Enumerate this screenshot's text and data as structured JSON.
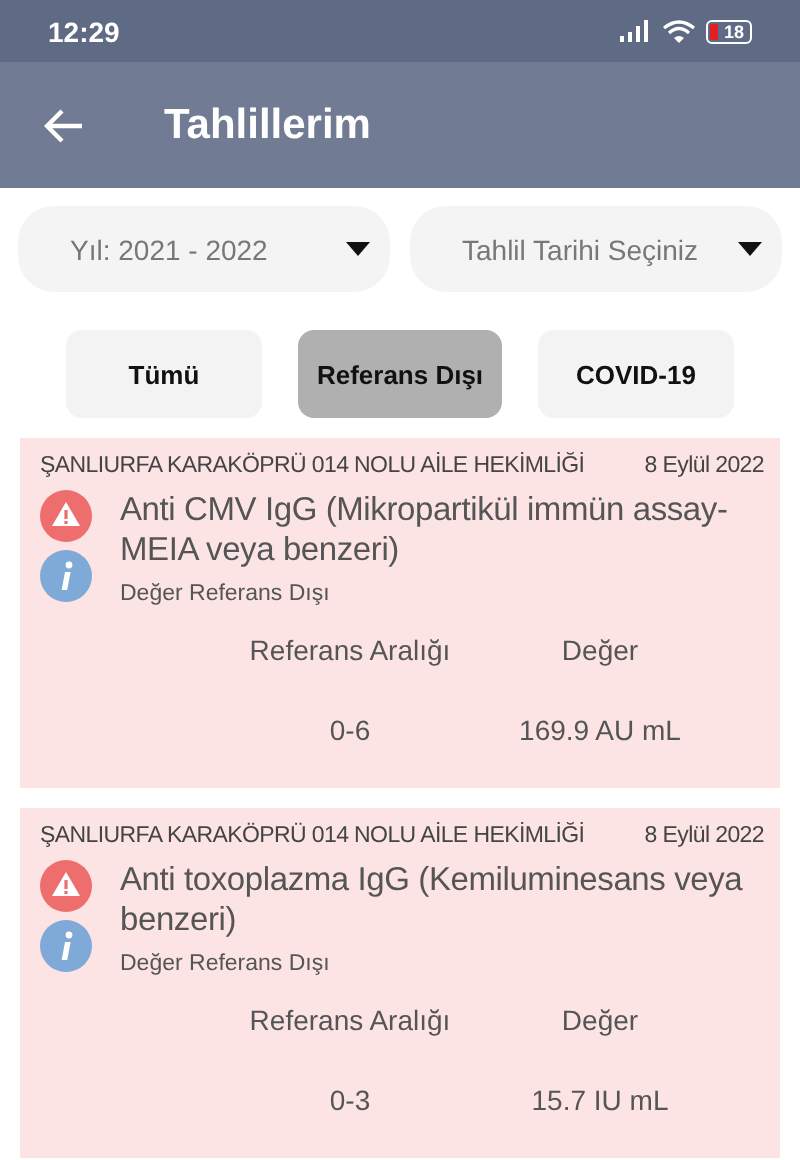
{
  "status_bar": {
    "time": "12:29",
    "battery": "18"
  },
  "app_bar": {
    "title": "Tahlillerim"
  },
  "dropdowns": [
    {
      "value": "Yıl: 2021 - 2022"
    },
    {
      "value": "Tahlil Tarihi Seçiniz"
    }
  ],
  "filters": [
    {
      "label": "Tümü",
      "selected": false
    },
    {
      "label": "Referans Dışı",
      "selected": true
    },
    {
      "label": "COVID-19",
      "selected": false
    }
  ],
  "results": [
    {
      "facility": "ŞANLIURFA KARAKÖPRÜ 014 NOLU AİLE HEKİMLİĞİ",
      "date": "8 Eylül 2022",
      "test": "Anti CMV IgG (Mikropartikül immün assay-MEIA veya benzeri)",
      "status": "Değer Referans Dışı",
      "out_of_range": true,
      "range_label": "Referans Aralığı",
      "value_label": "Değer",
      "range": "0-6",
      "value": "169.9 AU mL"
    },
    {
      "facility": "ŞANLIURFA KARAKÖPRÜ 014 NOLU AİLE HEKİMLİĞİ",
      "date": "8 Eylül 2022",
      "test": "Anti toxoplazma IgG (Kemiluminesans veya benzeri)",
      "status": "Değer Referans Dışı",
      "out_of_range": true,
      "range_label": "Referans Aralığı",
      "value_label": "Değer",
      "range": "0-3",
      "value": "15.7 IU mL"
    }
  ]
}
